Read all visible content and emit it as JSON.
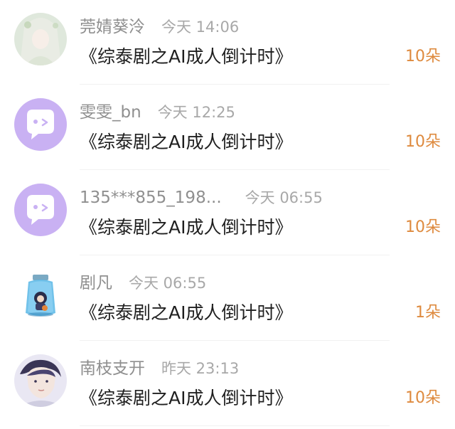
{
  "gift_records": [
    {
      "user": "莞婧葵泠",
      "time": "今天 14:06",
      "title": "《综泰剧之AI成人倒计时》",
      "gift": "10朵",
      "avatar": "anime-white-hair-girl-avatar"
    },
    {
      "user": "雯雯_bn",
      "time": "今天 12:25",
      "title": "《综泰剧之AI成人倒计时》",
      "gift": "10朵",
      "avatar": "default-chat-bubble-avatar"
    },
    {
      "user": "135***855_198...",
      "time": "今天 06:55",
      "title": "《综泰剧之AI成人倒计时》",
      "gift": "10朵",
      "avatar": "default-chat-bubble-avatar"
    },
    {
      "user": "剧凡",
      "time": "今天 06:55",
      "title": "《综泰剧之AI成人倒计时》",
      "gift": "1朵",
      "avatar": "bottle-character-avatar"
    },
    {
      "user": "南枝支开",
      "time": "昨天 23:13",
      "title": "《综泰剧之AI成人倒计时》",
      "gift": "10朵",
      "avatar": "purple-hair-boy-avatar"
    }
  ],
  "colors": {
    "gift_accent": "#de8a3e",
    "default_avatar_bg": "#c9b1f3",
    "title_text": "#1f1f1f",
    "meta_text": "#9a9a9a"
  }
}
